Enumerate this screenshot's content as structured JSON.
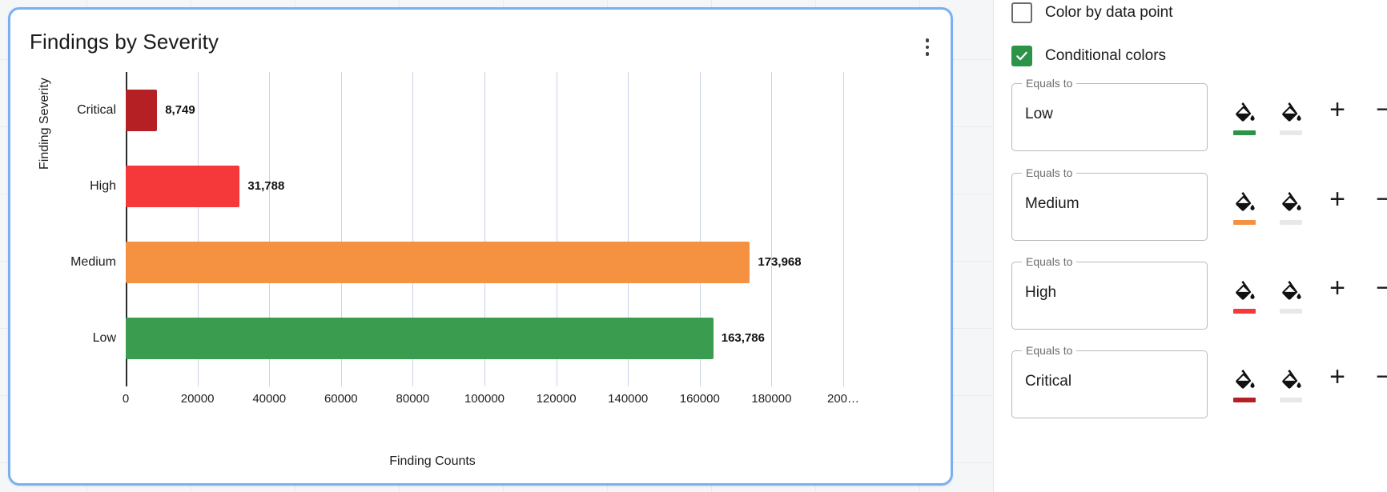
{
  "card": {
    "title": "Findings by Severity",
    "menu_icon": "kebab-menu-icon"
  },
  "chart_data": {
    "type": "bar",
    "orientation": "horizontal",
    "title": "Findings by Severity",
    "xlabel": "Finding Counts",
    "ylabel": "Finding Severity",
    "categories": [
      "Critical",
      "High",
      "Medium",
      "Low"
    ],
    "values": [
      8749,
      31788,
      173968,
      163786
    ],
    "value_labels": [
      "8,749",
      "31,788",
      "173,968",
      "163,786"
    ],
    "colors": [
      "#b52025",
      "#f5383a",
      "#f59242",
      "#3a9c4e"
    ],
    "xlim": [
      0,
      200000
    ],
    "xticks": [
      0,
      20000,
      40000,
      60000,
      80000,
      100000,
      120000,
      140000,
      160000,
      180000,
      200000
    ],
    "xtick_labels": [
      "0",
      "20000",
      "40000",
      "60000",
      "80000",
      "100000",
      "120000",
      "140000",
      "160000",
      "180000",
      "200…"
    ],
    "grid": true,
    "legend": "none"
  },
  "panel": {
    "checkboxes": [
      {
        "label": "Color by data point",
        "checked": false
      },
      {
        "label": "Conditional colors",
        "checked": true
      }
    ],
    "rules": [
      {
        "legend": "Equals to",
        "value": "Low",
        "fill_icon": "paint-bucket-icon",
        "text_fill_icon": "paint-bucket-icon",
        "fill_color": "#2d9349",
        "text_color": "#e8e8e8",
        "add_label": "+",
        "remove_label": "−"
      },
      {
        "legend": "Equals to",
        "value": "Medium",
        "fill_icon": "paint-bucket-icon",
        "text_fill_icon": "paint-bucket-icon",
        "fill_color": "#f59242",
        "text_color": "#e8e8e8",
        "add_label": "+",
        "remove_label": "−"
      },
      {
        "legend": "Equals to",
        "value": "High",
        "fill_icon": "paint-bucket-icon",
        "text_fill_icon": "paint-bucket-icon",
        "fill_color": "#f5383a",
        "text_color": "#e8e8e8",
        "add_label": "+",
        "remove_label": "−"
      },
      {
        "legend": "Equals to",
        "value": "Critical",
        "fill_icon": "paint-bucket-icon",
        "text_fill_icon": "paint-bucket-icon",
        "fill_color": "#b52025",
        "text_color": "#e8e8e8",
        "add_label": "+",
        "remove_label": "−"
      }
    ]
  }
}
